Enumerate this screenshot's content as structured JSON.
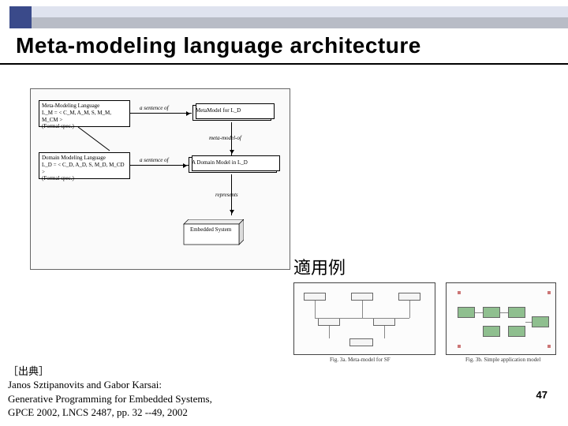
{
  "header": {
    "title": "Meta-modeling language architecture"
  },
  "diagram": {
    "meta_lang_box": "Meta-Modeling Language\nL_M = < C_M, A_M, S, M_M, M_CM >\n(Formal spec.)",
    "metamodel_box": "MetaModel for L_D",
    "domain_lang_box": "Domain Modeling Language\nL_D = < C_D, A_D, S, M_D, M_CD >\n(Formal spec.)",
    "domain_model_box": "A Domain Model in L_D",
    "embedded_box": "Embedded\nSystem",
    "rel_sentence_of": "a sentence of",
    "rel_metamodel_of": "meta-model-of",
    "rel_represents": "represents"
  },
  "example": {
    "label": "適用例",
    "caption_left": "Fig. 3a. Meta-model for SF",
    "caption_right": "Fig. 3b. Simple application model"
  },
  "citation": {
    "line1": "［出典］",
    "line2": "Janos Sztipanovits and Gabor Karsai:",
    "line3": "Generative Programming for Embedded Systems,",
    "line4": "GPCE 2002, LNCS 2487, pp. 32 --49, 2002"
  },
  "page_number": "47"
}
